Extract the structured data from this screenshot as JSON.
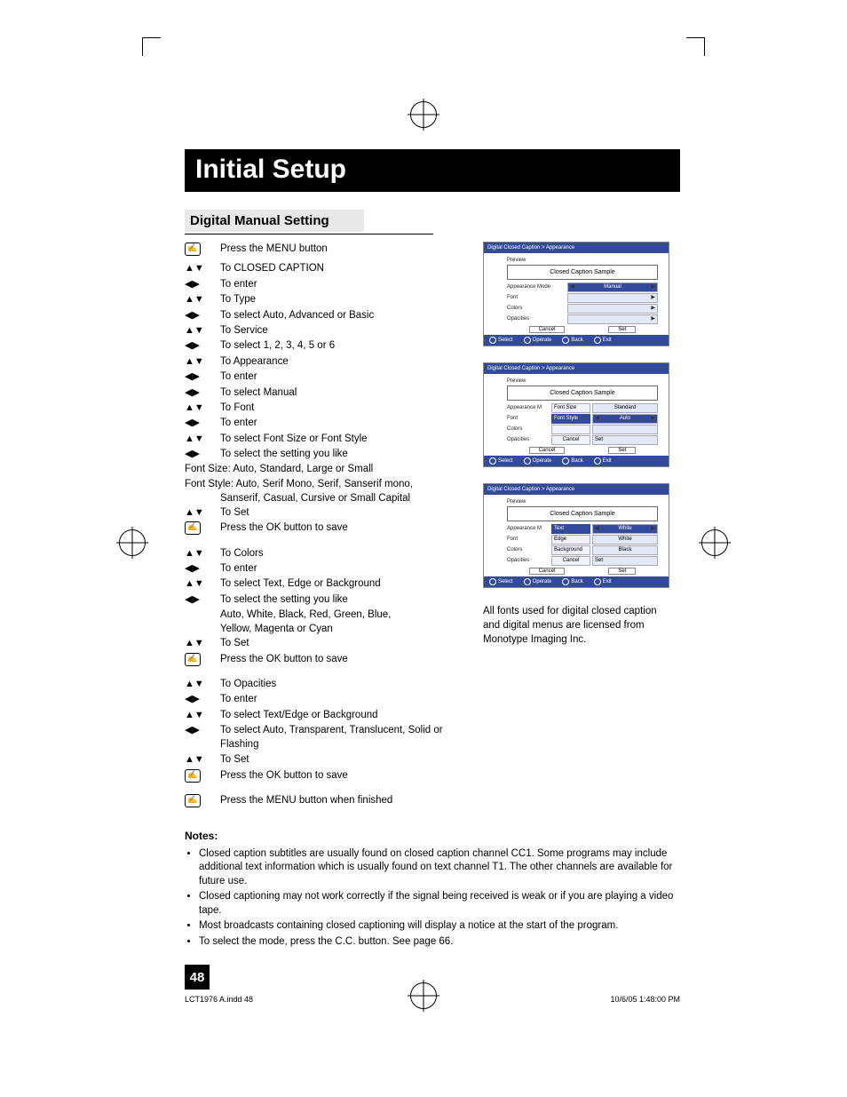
{
  "title": "Initial Setup",
  "section_heading": "Digital Manual Setting",
  "icons": {
    "menu": "☰",
    "ud": "▲▼",
    "lr": "◀▶"
  },
  "steps": [
    {
      "icon": "menu",
      "text": "Press the MENU button"
    },
    {
      "icon": "ud",
      "text": "To CLOSED CAPTION"
    },
    {
      "icon": "lr",
      "text": "To enter"
    },
    {
      "icon": "ud",
      "text": "To Type"
    },
    {
      "icon": "lr",
      "text": "To select Auto, Advanced or Basic"
    },
    {
      "icon": "ud",
      "text": "To Service"
    },
    {
      "icon": "lr",
      "text": "To select 1, 2, 3, 4, 5 or 6"
    },
    {
      "icon": "ud",
      "text": "To Appearance"
    },
    {
      "icon": "lr",
      "text": "To enter"
    },
    {
      "icon": "lr",
      "text": "To select Manual"
    },
    {
      "icon": "ud",
      "text": "To Font"
    },
    {
      "icon": "lr",
      "text": "To enter"
    },
    {
      "icon": "ud",
      "text": "To select Font Size or Font Style"
    },
    {
      "icon": "lr",
      "text": "To select the setting you like"
    }
  ],
  "font_size_line": "Font Size: Auto, Standard, Large or Small",
  "font_style_line1": "Font Style: Auto, Serif Mono, Serif, Sanserif mono,",
  "font_style_line2": "Sanserif, Casual, Cursive or Small Capital",
  "steps2": [
    {
      "icon": "ud",
      "text": "To Set"
    },
    {
      "icon": "menu",
      "text": "Press the OK button to save"
    }
  ],
  "steps3": [
    {
      "icon": "ud",
      "text": "To Colors"
    },
    {
      "icon": "lr",
      "text": "To enter"
    },
    {
      "icon": "ud",
      "text": "To select Text, Edge or Background"
    },
    {
      "icon": "lr",
      "text": "To select the setting you like"
    }
  ],
  "colors_sub1": "Auto, White, Black, Red, Green, Blue,",
  "colors_sub2": "Yellow, Magenta or Cyan",
  "steps4": [
    {
      "icon": "ud",
      "text": "To Set"
    },
    {
      "icon": "menu",
      "text": "Press the OK button to save"
    }
  ],
  "steps5": [
    {
      "icon": "ud",
      "text": "To Opacities"
    },
    {
      "icon": "lr",
      "text": "To enter"
    },
    {
      "icon": "ud",
      "text": "To select Text/Edge or Background"
    },
    {
      "icon": "lr",
      "text": "To select Auto, Transparent, Translucent, Solid or Flashing"
    },
    {
      "icon": "ud",
      "text": "To Set"
    },
    {
      "icon": "menu",
      "text": "Press the OK button to save"
    }
  ],
  "final_step": {
    "icon": "menu",
    "text": "Press the MENU button when finished"
  },
  "osd_breadcrumb": "Digital Closed Caption  >  Appearance",
  "osd_preview_label": "Preview",
  "osd_preview_sample": "Closed Caption Sample",
  "osd1": {
    "rows": [
      {
        "k": "Appearance Mode",
        "v": "Manual",
        "hl": true,
        "lr": true
      },
      {
        "k": "Font",
        "v": "",
        "r": true
      },
      {
        "k": "Colors",
        "v": "",
        "r": true
      },
      {
        "k": "Opacities",
        "v": "",
        "r": true
      }
    ],
    "buttons": [
      "Cancel",
      "Set"
    ]
  },
  "osd2": {
    "rows": [
      {
        "k": "Appearance M",
        "sk": "Font Size",
        "v": "Standard"
      },
      {
        "k": "Font",
        "sk": "Font Style",
        "v": "Auto",
        "hl": true,
        "lr": true
      },
      {
        "k": "Colors",
        "sk": "",
        "v": ""
      },
      {
        "k": "Opacities",
        "sk": "Cancel",
        "v": "Set",
        "btn": true
      }
    ],
    "buttons": [
      "Cancel",
      "Set"
    ]
  },
  "osd3": {
    "rows": [
      {
        "k": "Appearance M",
        "sk": "Text",
        "v": "White",
        "hl": true,
        "lr": true
      },
      {
        "k": "Font",
        "sk": "Edge",
        "v": "White"
      },
      {
        "k": "Colors",
        "sk": "Background",
        "v": "Black"
      },
      {
        "k": "Opacities",
        "sk": "Cancel",
        "v": "Set",
        "btn": true
      }
    ],
    "buttons": [
      "Cancel",
      "Set"
    ]
  },
  "osd_footer": [
    "Select",
    "Operate",
    "Back",
    "Exit"
  ],
  "osd_footer_small": [
    "",
    "",
    "BACK",
    "MENU"
  ],
  "right_note": "All fonts used for digital closed caption and digital menus are licensed from Monotype Imaging Inc.",
  "notes_heading": "Notes:",
  "notes": [
    "Closed caption subtitles are usually found on closed caption channel CC1. Some programs may include additional text information which is usually found on text channel T1. The other channels are available for future use.",
    "Closed captioning may not work correctly if the signal being received is weak or if you are playing a video tape.",
    "Most broadcasts containing closed captioning will display a notice at the start of the program.",
    "To select the mode, press the C.C. button. See page 66."
  ],
  "page_number": "48",
  "footer_left": "LCT1976 A.indd   48",
  "footer_right": "10/6/05   1:48:00 PM"
}
